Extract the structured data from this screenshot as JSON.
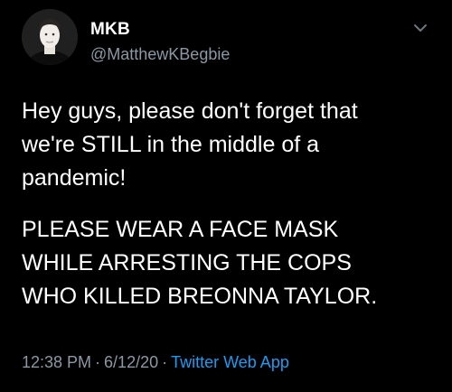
{
  "author": {
    "display_name": "MKB",
    "handle": "@MatthewKBegbie"
  },
  "icons": {
    "avatar": "profile-photo",
    "menu": "chevron-down-icon"
  },
  "tweet": {
    "paragraph1": [
      "Hey guys, please don't forget that",
      "we're STILL in the middle of a",
      "pandemic!"
    ],
    "paragraph2": [
      "PLEASE WEAR A FACE MASK",
      "WHILE ARRESTING THE COPS",
      "WHO KILLED BREONNA TAYLOR."
    ]
  },
  "meta": {
    "time": "12:38 PM",
    "separator": "·",
    "date": "6/12/20",
    "source": "Twitter Web App"
  },
  "colors": {
    "background": "#000000",
    "text": "#ffffff",
    "secondary": "#8b98a5",
    "link": "#1d9bf0"
  }
}
